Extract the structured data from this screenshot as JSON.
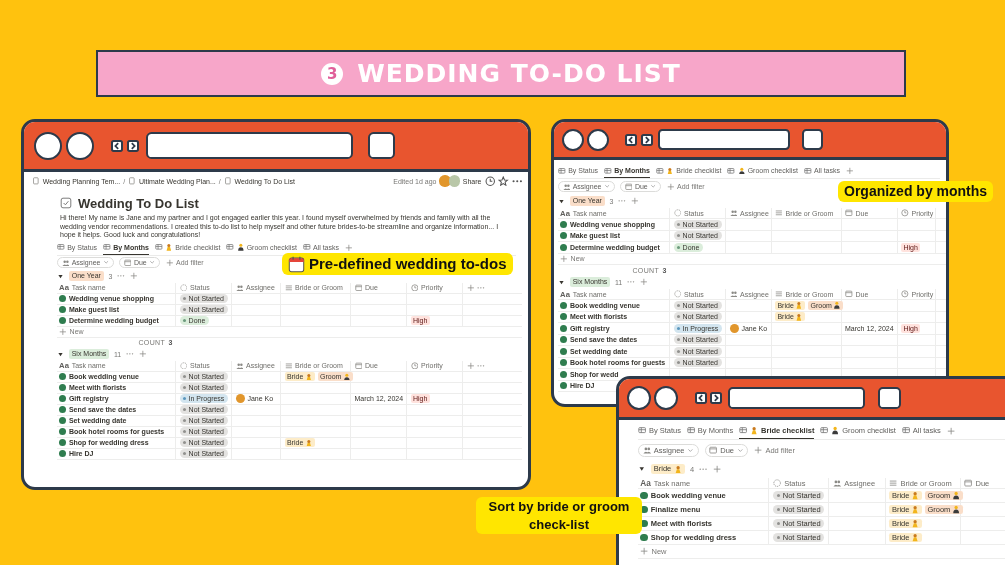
{
  "banner": {
    "number": "3",
    "title": "WEDDING TO-DO LIST"
  },
  "windows": [
    {
      "kind": "page",
      "breadcrumbs": {
        "separator": "/",
        "items": [
          "Wedding Planning Tem...",
          "Ultimate Wedding Plan...",
          "Wedding To Do List"
        ]
      },
      "edited": "Edited 1d ago",
      "share": "Share",
      "title": "Wedding To Do List",
      "description": "Hi there! My name is Jane and my partner and I got engaged earlier this year. I found myself overwhelmed by friends and family with all the wedding vendor recommendations. I created this to-do list to help myself and other future brides-to-be streamline and organize information... I hope it helps. Good luck and congratulations!",
      "tabs": [
        {
          "label": "By Status",
          "kind": "plain",
          "selected": false
        },
        {
          "label": "By Months",
          "kind": "plain",
          "selected": true
        },
        {
          "label": "Bride checklist",
          "kind": "bride",
          "selected": false
        },
        {
          "label": "Groom checklist",
          "kind": "groom",
          "selected": false
        },
        {
          "label": "All tasks",
          "kind": "plain",
          "selected": false
        }
      ],
      "filters": [
        {
          "label": "Assignee",
          "kind": "people"
        },
        {
          "label": "Due",
          "kind": "date"
        }
      ],
      "add_filter": "Add filter",
      "column_tools": true,
      "groups": [
        {
          "label": "One Year",
          "kind": "plain",
          "color": "#fadec9",
          "count": "3",
          "new": "New",
          "footer": {
            "label": "COUNT",
            "value": "3"
          },
          "columns": [
            {
              "label": "Task name",
              "kind": "title",
              "icon_text": "Aa"
            },
            {
              "label": "Status",
              "kind": "status"
            },
            {
              "label": "Assignee",
              "kind": "people"
            },
            {
              "label": "Bride or Groom",
              "kind": "list"
            },
            {
              "label": "Due",
              "kind": "date"
            },
            {
              "label": "Priority",
              "kind": "priority"
            }
          ],
          "rows": [
            {
              "name": "Wedding venue shopping",
              "status": {
                "label": "Not Started",
                "kind": "not_started"
              }
            },
            {
              "name": "Make guest list",
              "status": {
                "label": "Not Started",
                "kind": "not_started"
              }
            },
            {
              "name": "Determine wedding budget",
              "status": {
                "label": "Done",
                "kind": "done"
              },
              "priority": {
                "label": "High",
                "kind": "high"
              }
            }
          ]
        },
        {
          "label": "Six Months",
          "kind": "plain",
          "color": "#dbeddb",
          "count": "11",
          "columns": [
            {
              "label": "Task name",
              "kind": "title",
              "icon_text": "Aa"
            },
            {
              "label": "Status",
              "kind": "status"
            },
            {
              "label": "Assignee",
              "kind": "people"
            },
            {
              "label": "Bride or Groom",
              "kind": "list"
            },
            {
              "label": "Due",
              "kind": "date"
            },
            {
              "label": "Priority",
              "kind": "priority"
            }
          ],
          "rows": [
            {
              "name": "Book wedding venue",
              "status": {
                "label": "Not Started",
                "kind": "not_started"
              },
              "tags": [
                {
                  "label": "Bride",
                  "kind": "bride"
                },
                {
                  "label": "Groom",
                  "kind": "groom"
                }
              ]
            },
            {
              "name": "Meet with florists",
              "status": {
                "label": "Not Started",
                "kind": "not_started"
              }
            },
            {
              "name": "Gift registry",
              "status": {
                "label": "In Progress",
                "kind": "in_progress"
              },
              "assignee": "Jane Ko",
              "due": "March 12, 2024",
              "priority": {
                "label": "High",
                "kind": "high"
              }
            },
            {
              "name": "Send save the dates",
              "status": {
                "label": "Not Started",
                "kind": "not_started"
              }
            },
            {
              "name": "Set wedding date",
              "status": {
                "label": "Not Started",
                "kind": "not_started"
              }
            },
            {
              "name": "Book hotel rooms for guests",
              "status": {
                "label": "Not Started",
                "kind": "not_started"
              }
            },
            {
              "name": "Shop for wedding dress",
              "status": {
                "label": "Not Started",
                "kind": "not_started"
              },
              "tags": [
                {
                  "label": "Bride",
                  "kind": "bride"
                }
              ]
            },
            {
              "name": "Hire DJ",
              "status": {
                "label": "Not Started",
                "kind": "not_started"
              }
            }
          ]
        }
      ]
    },
    {
      "kind": "view",
      "tabs": [
        {
          "label": "By Status",
          "kind": "plain",
          "selected": false
        },
        {
          "label": "By Months",
          "kind": "plain",
          "selected": true
        },
        {
          "label": "Bride checklist",
          "kind": "bride",
          "selected": false
        },
        {
          "label": "Groom checklist",
          "kind": "groom",
          "selected": false
        },
        {
          "label": "All tasks",
          "kind": "plain",
          "selected": false
        }
      ],
      "filters": [
        {
          "label": "Assignee",
          "kind": "people"
        },
        {
          "label": "Due",
          "kind": "date"
        }
      ],
      "add_filter": "Add filter",
      "column_tools": false,
      "groups": [
        {
          "label": "One Year",
          "kind": "plain",
          "color": "#fadec9",
          "count": "3",
          "new": "New",
          "footer": {
            "label": "COUNT",
            "value": "3"
          },
          "columns": [
            {
              "label": "Task name",
              "kind": "title",
              "icon_text": "Aa"
            },
            {
              "label": "Status",
              "kind": "status"
            },
            {
              "label": "Assignee",
              "kind": "people"
            },
            {
              "label": "Bride or Groom",
              "kind": "list"
            },
            {
              "label": "Due",
              "kind": "date"
            },
            {
              "label": "Priority",
              "kind": "priority"
            }
          ],
          "rows": [
            {
              "name": "Wedding venue shopping",
              "status": {
                "label": "Not Started",
                "kind": "not_started"
              }
            },
            {
              "name": "Make guest list",
              "status": {
                "label": "Not Started",
                "kind": "not_started"
              }
            },
            {
              "name": "Determine wedding budget",
              "status": {
                "label": "Done",
                "kind": "done"
              },
              "priority": {
                "label": "High",
                "kind": "high"
              }
            }
          ]
        },
        {
          "label": "Six Months",
          "kind": "plain",
          "color": "#dbeddb",
          "count": "11",
          "columns": [
            {
              "label": "Task name",
              "kind": "title",
              "icon_text": "Aa"
            },
            {
              "label": "Status",
              "kind": "status"
            },
            {
              "label": "Assignee",
              "kind": "people"
            },
            {
              "label": "Bride or Groom",
              "kind": "list"
            },
            {
              "label": "Due",
              "kind": "date"
            },
            {
              "label": "Priority",
              "kind": "priority"
            }
          ],
          "rows": [
            {
              "name": "Book wedding venue",
              "status": {
                "label": "Not Started",
                "kind": "not_started"
              },
              "tags": [
                {
                  "label": "Bride",
                  "kind": "bride"
                },
                {
                  "label": "Groom",
                  "kind": "groom"
                }
              ]
            },
            {
              "name": "Meet with florists",
              "status": {
                "label": "Not Started",
                "kind": "not_started"
              },
              "tags": [
                {
                  "label": "Bride",
                  "kind": "bride"
                }
              ]
            },
            {
              "name": "Gift registry",
              "status": {
                "label": "In Progress",
                "kind": "in_progress"
              },
              "assignee": "Jane Ko",
              "due": "March 12, 2024",
              "priority": {
                "label": "High",
                "kind": "high"
              }
            },
            {
              "name": "Send save the dates",
              "status": {
                "label": "Not Started",
                "kind": "not_started"
              }
            },
            {
              "name": "Set wedding date",
              "status": {
                "label": "Not Started",
                "kind": "not_started"
              }
            },
            {
              "name": "Book hotel rooms for guests",
              "status": {
                "label": "Not Started",
                "kind": "not_started"
              }
            },
            {
              "name": "Shop for wedd"
            },
            {
              "name": "Hire DJ"
            }
          ]
        }
      ]
    },
    {
      "kind": "view",
      "tabs": [
        {
          "label": "By Status",
          "kind": "plain",
          "selected": false
        },
        {
          "label": "By Months",
          "kind": "plain",
          "selected": false
        },
        {
          "label": "Bride checklist",
          "kind": "bride",
          "selected": true
        },
        {
          "label": "Groom checklist",
          "kind": "groom",
          "selected": false
        },
        {
          "label": "All tasks",
          "kind": "plain",
          "selected": false
        }
      ],
      "filters": [
        {
          "label": "Assignee",
          "kind": "people"
        },
        {
          "label": "Due",
          "kind": "date"
        }
      ],
      "add_filter": "Add filter",
      "column_tools": false,
      "groups": [
        {
          "label": "Bride",
          "kind": "bride",
          "color": "#fdecc8",
          "count": "4",
          "new": "New",
          "columns": [
            {
              "label": "Task name",
              "kind": "title",
              "icon_text": "Aa"
            },
            {
              "label": "Status",
              "kind": "status"
            },
            {
              "label": "Assignee",
              "kind": "people"
            },
            {
              "label": "Bride or Groom",
              "kind": "list"
            },
            {
              "label": "Due",
              "kind": "date"
            }
          ],
          "rows": [
            {
              "name": "Book wedding venue",
              "status": {
                "label": "Not Started",
                "kind": "not_started"
              },
              "tags": [
                {
                  "label": "Bride",
                  "kind": "bride"
                },
                {
                  "label": "Groom",
                  "kind": "groom"
                }
              ]
            },
            {
              "name": "Finalize menu",
              "status": {
                "label": "Not Started",
                "kind": "not_started"
              },
              "tags": [
                {
                  "label": "Bride",
                  "kind": "bride"
                },
                {
                  "label": "Groom",
                  "kind": "groom"
                }
              ]
            },
            {
              "name": "Meet with florists",
              "status": {
                "label": "Not Started",
                "kind": "not_started"
              },
              "tags": [
                {
                  "label": "Bride",
                  "kind": "bride"
                }
              ]
            },
            {
              "name": "Shop for wedding dress",
              "status": {
                "label": "Not Started",
                "kind": "not_started"
              },
              "tags": [
                {
                  "label": "Bride",
                  "kind": "bride"
                }
              ]
            }
          ]
        }
      ]
    }
  ],
  "callouts": [
    {
      "text": "Pre-defined wedding to-dos",
      "kind": "calendar"
    },
    {
      "text": "Organized by months",
      "kind": "plain"
    },
    {
      "text": "Sort by bride or groom check-list",
      "kind": "plain"
    }
  ]
}
